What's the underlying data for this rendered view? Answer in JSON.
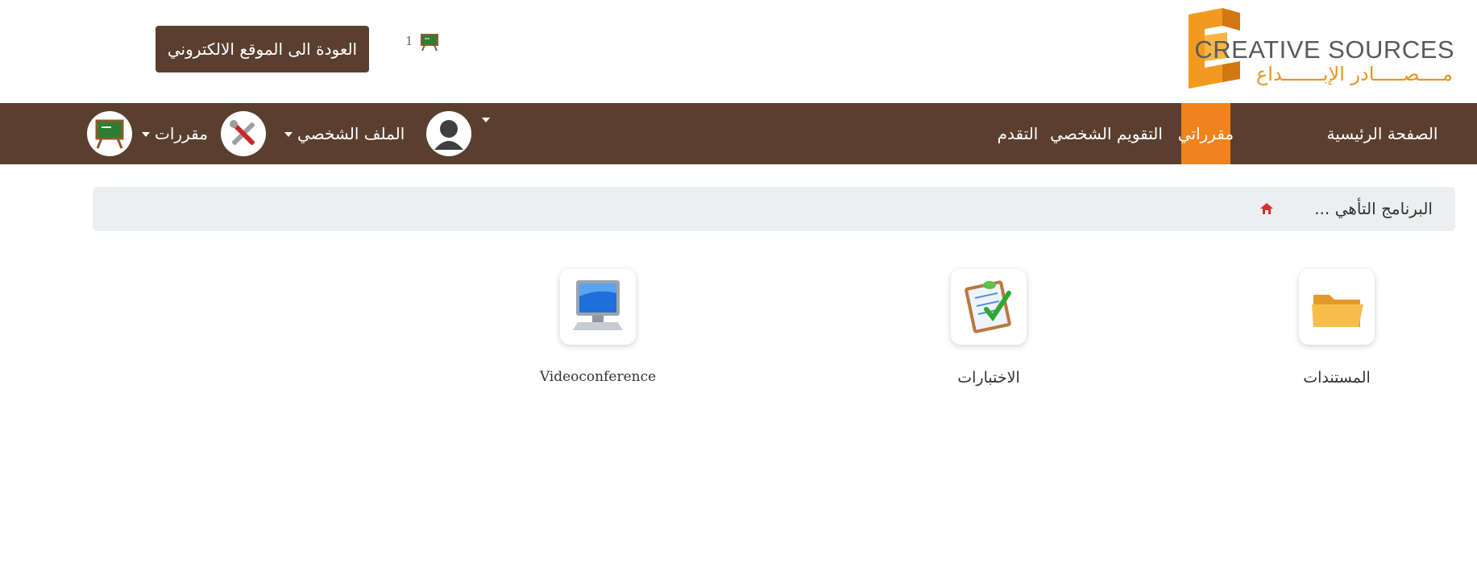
{
  "header": {
    "logo_en": "CREATIVE SOURCES",
    "logo_ar": "مــــصـــــادر الإبـــــــداع",
    "back_button_label": "العودة الى الموقع الالكتروني",
    "course_counter": "1"
  },
  "navbar": {
    "items": [
      {
        "label": "الصفحة الرئيسية",
        "active": false
      },
      {
        "label": "مقرراتي",
        "active": true
      },
      {
        "label": "التقويم الشخصي",
        "active": false
      },
      {
        "label": "التقدم",
        "active": false
      }
    ],
    "profile_label": "الملف الشخصي",
    "courses_label": "مقررات"
  },
  "breadcrumb": {
    "text": "البرنامج التأهي ..."
  },
  "tools": [
    {
      "label": "المستندات",
      "icon": "folder-icon"
    },
    {
      "label": "الاختبارات",
      "icon": "quiz-checklist-icon"
    },
    {
      "label": "Videoconference",
      "icon": "computer-monitor-icon"
    }
  ],
  "colors": {
    "navbar_bg": "#5a3f2f",
    "active_tab": "#f0831e",
    "brand_orange": "#e8951f",
    "breadcrumb_bg": "#eceeef"
  }
}
